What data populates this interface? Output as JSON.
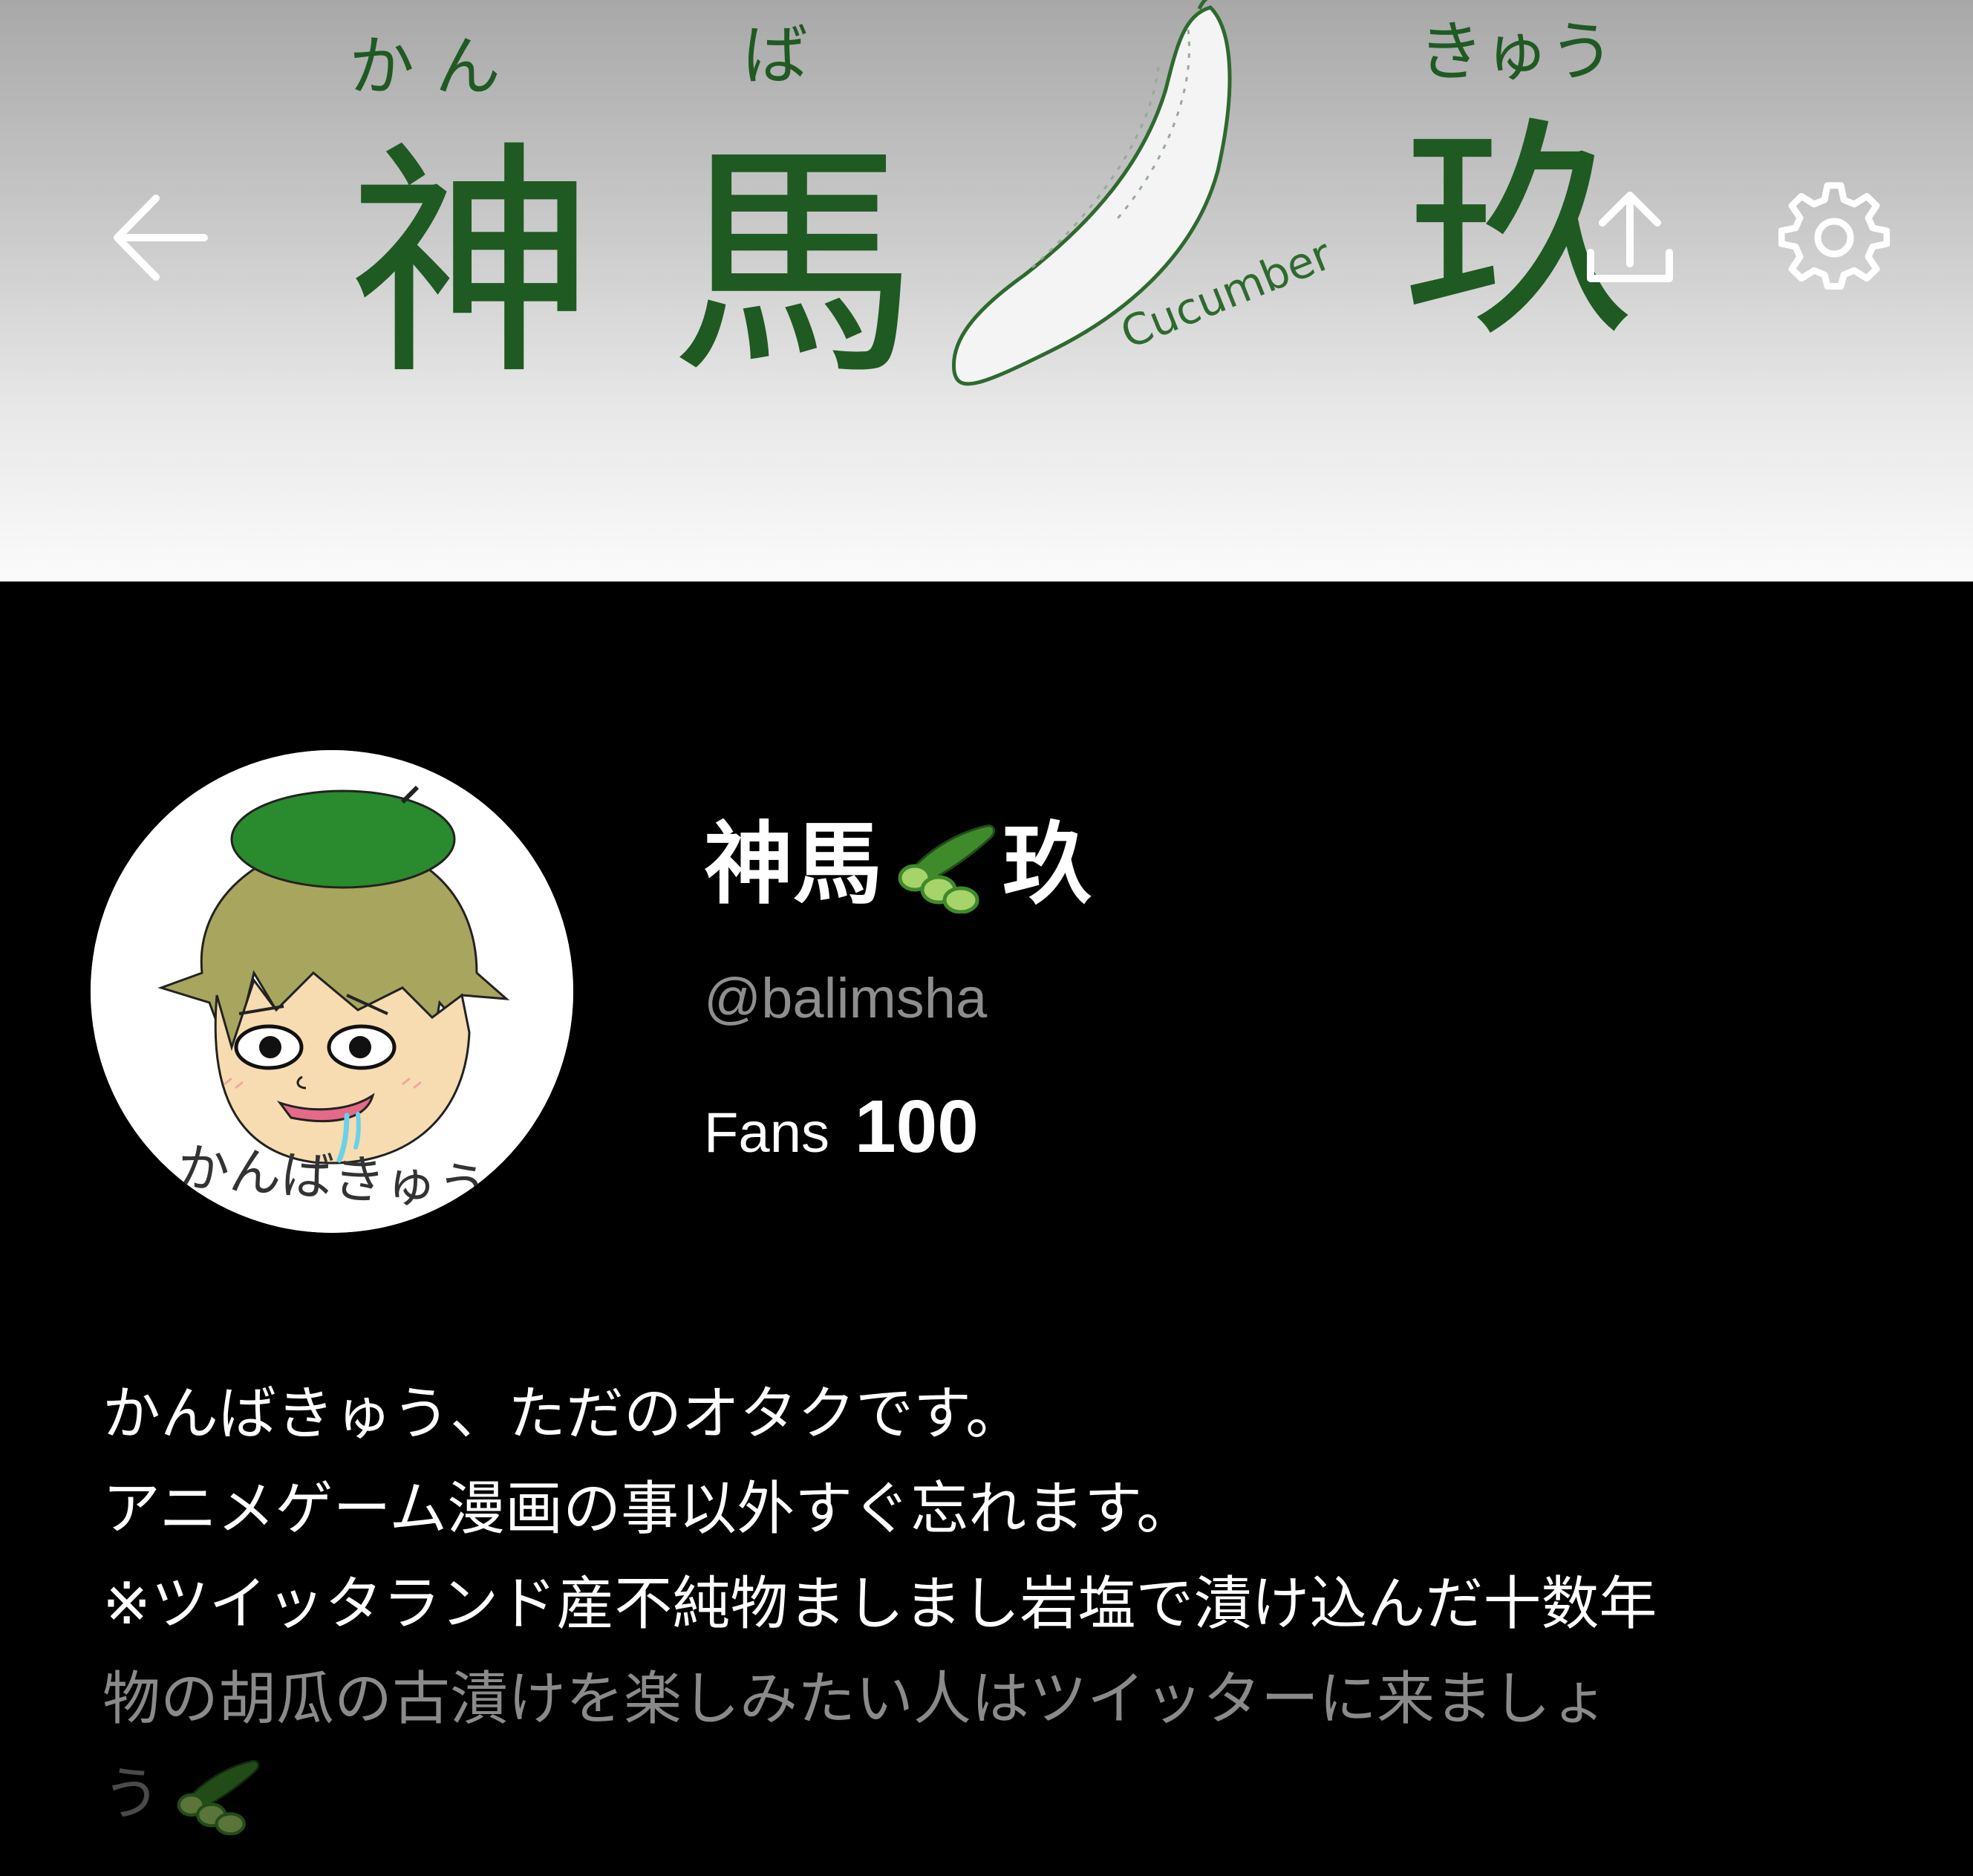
{
  "banner": {
    "title_text": "神 馬",
    "title_text_2": "玖",
    "furigana_1": "か ん",
    "furigana_2": "ば",
    "furigana_3": "きゅう",
    "cucumber_label": "Cucumber"
  },
  "header": {
    "back_icon": "arrow-left-icon",
    "share_icon": "share-upload-icon",
    "settings_icon": "gear-icon"
  },
  "profile": {
    "avatar_caption": "かんばきゅう",
    "name_part_1": "神馬",
    "name_emoji": "cucumber-emoji",
    "name_part_2": "玖",
    "handle": "@balimsha",
    "fans_label": "Fans",
    "fans_count": "100"
  },
  "bio": {
    "lines": [
      "かんばきゅう、ただのオタクです。",
      "アニメゲーム漫画の事以外すぐ忘れます。",
      "※ツイッタランド産不純物ましまし岩塩で漬け込んだ十数年",
      "物の胡瓜の古漬けを楽しみたい人はツイッターに来ましょ",
      "う"
    ],
    "trailing_emoji": "cucumber-emoji"
  },
  "colors": {
    "background": "#000000",
    "text_primary": "#ffffff",
    "text_secondary": "#8e8e8e",
    "banner_ink": "#1f5a22",
    "cucumber_green": "#3f8a2a"
  }
}
